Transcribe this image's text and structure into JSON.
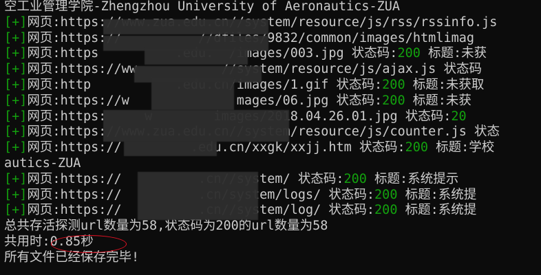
{
  "header": {
    "text": "空工业管理学院-Zhengzhou University of Aeronautics-ZUA"
  },
  "tag": "[+]",
  "web_label": "网页:",
  "status_label": " 状态码:",
  "title_label": " 标题:",
  "rows1": [
    {
      "url": "https://www.zua.edu.cn//system/resource/js/rss/rssinfo.js",
      "code": "",
      "title": ""
    },
    {
      "url": "https://          //dfiles/9832/common/images/htmlimag",
      "code": "",
      "title": ""
    },
    {
      "url": "https          .edu.  /images/003.jpg",
      "code": "200",
      "title": "未获"
    },
    {
      "url": "https://ww           //system/resource/js/ajax.js 状态码",
      "code": "",
      "title": ""
    },
    {
      "url": "http           .edu.cn/images/1.gif",
      "code": "200",
      "title": "未获取"
    },
    {
      "url": "https://w              mages/06.jpg",
      "code": "200",
      "title": "未获"
    },
    {
      "url": "https:     w        images/2018.04.26.01.jpg",
      "code": "20",
      "title": ""
    },
    {
      "url": "https://www.zua.edu.cn//system/resource/js/counter.js 状态",
      "code": "",
      "title": ""
    },
    {
      "url": "https://         .edu.cn/xxgk/xxjj.htm",
      "code": "200",
      "title": "学校"
    }
  ],
  "mid_line": "autics-ZUA",
  "rows2": [
    {
      "url": "https://          .cn//system/",
      "code": "200",
      "title": "系统提示"
    },
    {
      "url": "https://          .cn/system/logs/",
      "code": "200",
      "title": "系统提"
    },
    {
      "url": "https://          .cn//system/log/",
      "code": "200",
      "title": "系统提"
    }
  ],
  "summary": "总共存活探测url数量为58,状态码为200的url数量为58",
  "time_line": "共用时:0.85秒",
  "done_line": "所有文件已经保存完毕!",
  "colors": {
    "background": "#0c0c0c",
    "text": "#cccccc",
    "status_green": "#13a10e",
    "highlight_circle": "#e81123"
  }
}
